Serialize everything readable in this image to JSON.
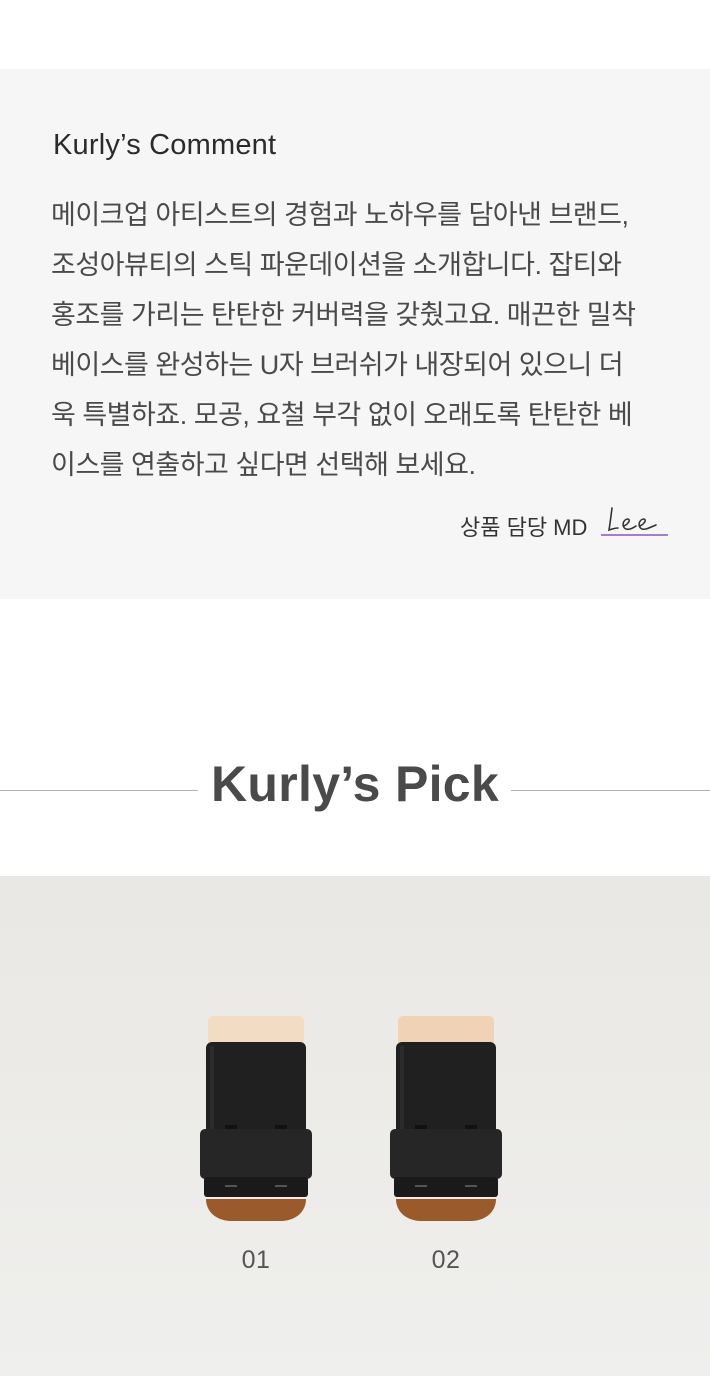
{
  "comment": {
    "title": "Kurly’s Comment",
    "lines": [
      "메이크업 아티스트의 경험과 노하우를 담아낸 브랜드,",
      "조성아뷰티의 스틱 파운데이션을 소개합니다. 잡티와",
      "홍조를 가리는 탄탄한 커버력을 갖췄고요. 매끈한 밀착",
      "베이스를 완성하는 U자 브러쉬가 내장되어 있으니 더",
      "욱 특별하죠. 모공, 요철 부각 없이 오래도록 탄탄한 베",
      "이스를 연출하고 싶다면 선택해 보세요."
    ],
    "md_label": "상품 담당 MD",
    "signature": "Lee",
    "signature_color": "#8a55c4"
  },
  "pick": {
    "title": "Kurly’s Pick"
  },
  "products": [
    {
      "label": "01",
      "shade_color": "#f3dcc4"
    },
    {
      "label": "02",
      "shade_color": "#efd3b4"
    }
  ],
  "colors": {
    "comment_bg": "#f6f6f6",
    "brush_color": "#9a5a2c",
    "case_color": "#1f1f1f"
  }
}
